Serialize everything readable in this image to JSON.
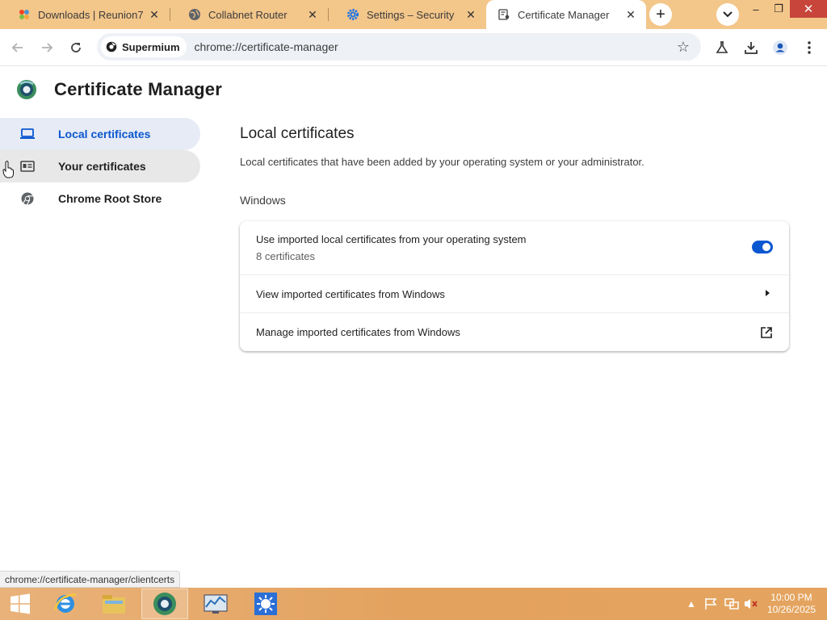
{
  "tabs": [
    {
      "title": "Downloads | Reunion7",
      "icon": "joomla-icon"
    },
    {
      "title": "Collabnet Router",
      "icon": "globe-icon"
    },
    {
      "title": "Settings – Security",
      "icon": "gear-icon"
    },
    {
      "title": "Certificate Manager",
      "icon": "certificate-icon"
    }
  ],
  "window": {
    "minimize": "–",
    "maximize": "❐",
    "close": "✕"
  },
  "toolbar": {
    "chip_label": "Supermium",
    "url": "chrome://certificate-manager"
  },
  "page": {
    "title": "Certificate Manager"
  },
  "sidebar": {
    "items": [
      {
        "label": "Local certificates",
        "icon": "laptop-icon"
      },
      {
        "label": "Your certificates",
        "icon": "id-card-icon"
      },
      {
        "label": "Chrome Root Store",
        "icon": "chrome-icon"
      }
    ]
  },
  "main": {
    "heading": "Local certificates",
    "description": "Local certificates that have been added by your operating system or your administrator.",
    "subheading": "Windows",
    "rows": [
      {
        "label": "Use imported local certificates from your operating system",
        "sublabel": "8 certificates",
        "toggle_on": true
      },
      {
        "label": "View imported certificates from Windows"
      },
      {
        "label": "Manage imported certificates from Windows"
      }
    ]
  },
  "status_url": "chrome://certificate-manager/clientcerts",
  "taskbar": {
    "clock_time": "10:00 PM",
    "clock_date": "10/26/2025"
  },
  "colors": {
    "accent": "#0b57d0",
    "tabstrip": "#f3c68a",
    "taskbar": "#e3a25e",
    "close_button": "#c7453a"
  }
}
